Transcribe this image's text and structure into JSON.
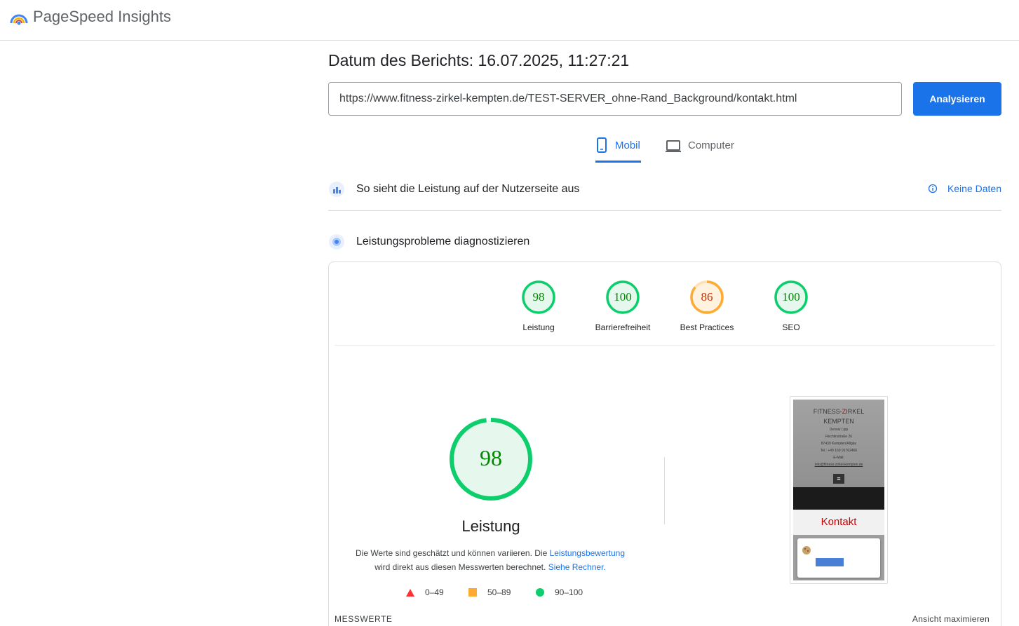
{
  "header": {
    "title": "PageSpeed Insights",
    "logo_icon": "pagespeed-logo-icon"
  },
  "report": {
    "date_label": "Datum des Berichts: 16.07.2025, 11:27:21"
  },
  "search": {
    "url_value": "https://www.fitness-zirkel-kempten.de/TEST-SERVER_ohne-Rand_Background/kontakt.html",
    "analyze_label": "Analysieren"
  },
  "tabs": [
    {
      "label": "Mobil",
      "active": true,
      "icon": "phone-icon"
    },
    {
      "label": "Computer",
      "active": false,
      "icon": "laptop-icon"
    }
  ],
  "field_section": {
    "title": "So sieht die Leistung auf der Nutzerseite aus",
    "no_data_label": "Keine Daten"
  },
  "lab_section": {
    "title": "Leistungsprobleme diagnostizieren"
  },
  "categories": [
    {
      "label": "Leistung",
      "score": 98,
      "status": "pass"
    },
    {
      "label": "Barrierefreiheit",
      "score": 100,
      "status": "pass"
    },
    {
      "label": "Best Practices",
      "score": 86,
      "status": "average"
    },
    {
      "label": "SEO",
      "score": 100,
      "status": "pass"
    }
  ],
  "performance": {
    "score": 98,
    "label": "Leistung",
    "desc_text1": "Die Werte sind geschätzt und können variieren. Die ",
    "desc_link1": "Leistungsbewertung",
    "desc_text2": "wird direkt aus diesen Messwerten berechnet. ",
    "desc_link2": "Siehe Rechner."
  },
  "legend": [
    {
      "range": "0–49",
      "color": "#ff3333"
    },
    {
      "range": "50–89",
      "color": "#ffaa33"
    },
    {
      "range": "90–100",
      "color": "#0cce6b"
    }
  ],
  "colors": {
    "pass": "#0cce6b",
    "pass_text": "#008800",
    "pass_bg": "#e6f8ee",
    "average": "#ffaa33",
    "average_text": "#c33300",
    "average_bg": "#fff3e0",
    "accent": "#1a73e8"
  },
  "screenshot": {
    "line1_a": "FITNESS-",
    "line1_b": "ZI",
    "line1_c": "RKEL",
    "line2": "KEMPTEN",
    "line3": "Dennis Lipp",
    "line4": "Rechtinstraße 26",
    "line5": "87439 Kempten/Allgäu",
    "line6": "Tel.: +49 160 91762466",
    "line7": "E-Mail:",
    "line8": "info@fitness-zirkel-kempten.de",
    "heading": "Kontakt"
  },
  "footer": {
    "metrics_label": "MESSWERTE",
    "expand_label": "Ansicht maximieren"
  }
}
